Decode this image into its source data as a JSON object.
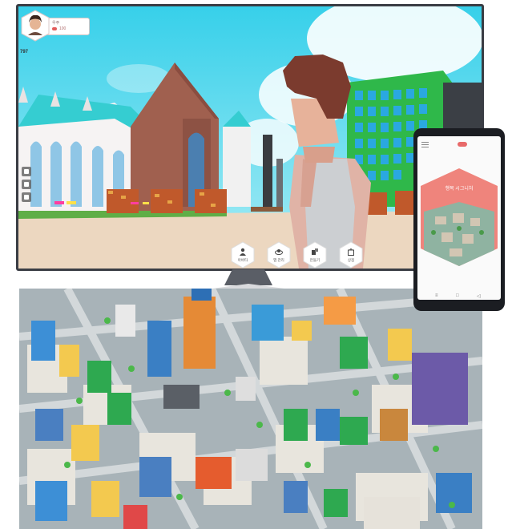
{
  "hud": {
    "player_name": "우주",
    "coins": "100",
    "score": "797",
    "avatar_icon": "player-avatar-icon"
  },
  "toolbar": {
    "items": [
      {
        "label": "아바타",
        "icon": "person-icon"
      },
      {
        "label": "맵 관리",
        "icon": "world-icon"
      },
      {
        "label": "만들기",
        "icon": "build-icon"
      },
      {
        "label": "상점",
        "icon": "shop-bag-icon"
      }
    ]
  },
  "side_tools": [
    "home-icon",
    "people-icon",
    "chat-icon"
  ],
  "phone": {
    "title": "행복 시그니처",
    "nav": [
      "≡",
      "□",
      "◁"
    ]
  },
  "colors": {
    "accent": "#e86a6a",
    "sky": "#3fd3ea",
    "grass": "#5fae47"
  }
}
